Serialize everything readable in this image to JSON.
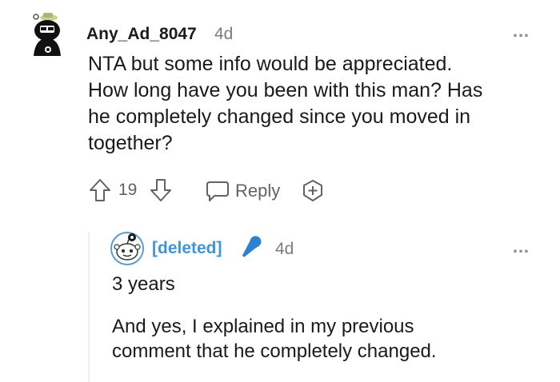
{
  "comment": {
    "author": "Any_Ad_8047",
    "age": "4d",
    "body_lines": [
      "NTA but some info would be appreciated.",
      "How long have you been with this man? Has",
      "he completely changed since you moved in",
      "together?"
    ],
    "score": "19",
    "reply_label": "Reply",
    "more_icon": "…"
  },
  "reply": {
    "author": "[deleted]",
    "age": "4d",
    "paragraph1": "3 years",
    "paragraph2_lines": [
      "And yes, I explained in my previous",
      "comment that he completely changed."
    ],
    "more_icon": "…"
  },
  "colors": {
    "deleted_author": "#3e95d8",
    "mic_badge": "#2b83d0",
    "meta_gray": "#7c7c7c"
  }
}
